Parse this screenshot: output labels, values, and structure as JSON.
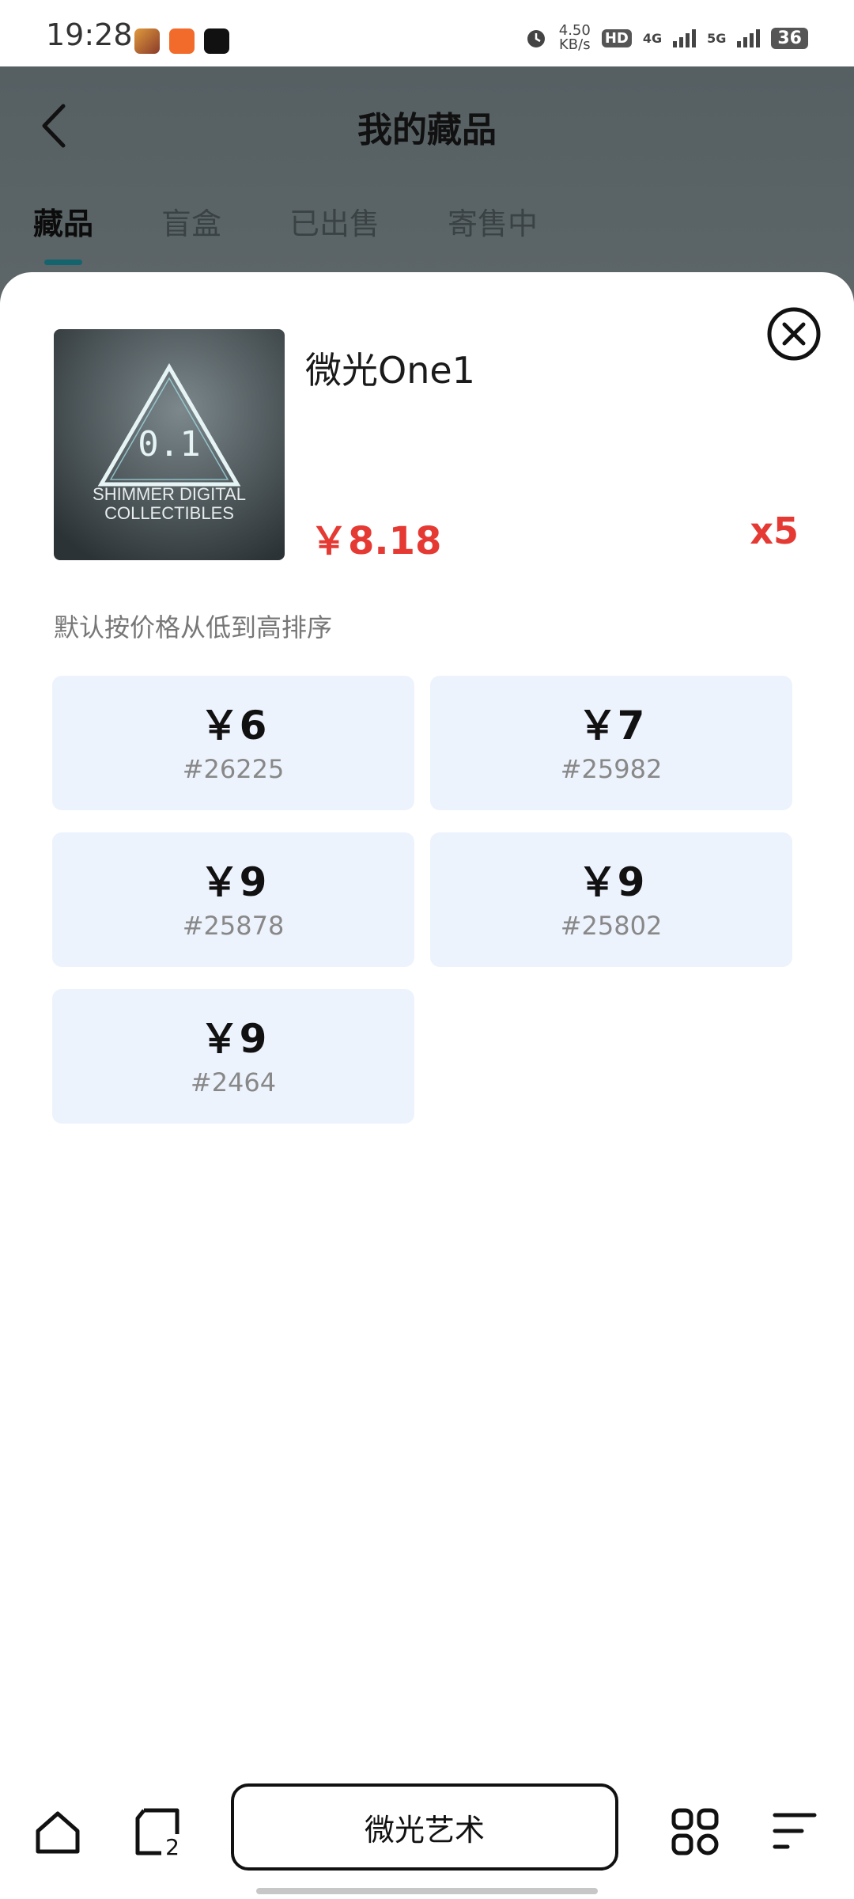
{
  "status_bar": {
    "time": "19:28",
    "net_speed_value": "4.50",
    "net_speed_unit": "KB/s",
    "hd_label": "HD",
    "network_4g": "4G",
    "network_5g": "5G",
    "battery": "36"
  },
  "header": {
    "title": "我的藏品",
    "tabs": [
      {
        "label": "藏品",
        "active": true
      },
      {
        "label": "盲盒",
        "active": false
      },
      {
        "label": "已出售",
        "active": false
      },
      {
        "label": "寄售中",
        "active": false
      }
    ]
  },
  "sheet": {
    "item_name": "微光One1",
    "price": "￥8.18",
    "quantity": "x5",
    "thumbnail": {
      "logo_text": "0.1",
      "line1": "SHIMMER DIGITAL",
      "line2": "COLLECTIBLES"
    },
    "sort_hint": "默认按价格从低到高排序",
    "listings": [
      {
        "price": "￥6",
        "id": "#26225"
      },
      {
        "price": "￥7",
        "id": "#25982"
      },
      {
        "price": "￥9",
        "id": "#25878"
      },
      {
        "price": "￥9",
        "id": "#25802"
      },
      {
        "price": "￥9",
        "id": "#2464"
      }
    ]
  },
  "bottom_nav": {
    "center_label": "微光艺术",
    "icons": [
      "home-icon",
      "wallet-icon",
      "grid-icon",
      "menu-icon"
    ],
    "badge_count": "2"
  },
  "colors": {
    "accent": "#14646e",
    "price_red": "#e53a33",
    "card_bg": "#edf3fd"
  }
}
